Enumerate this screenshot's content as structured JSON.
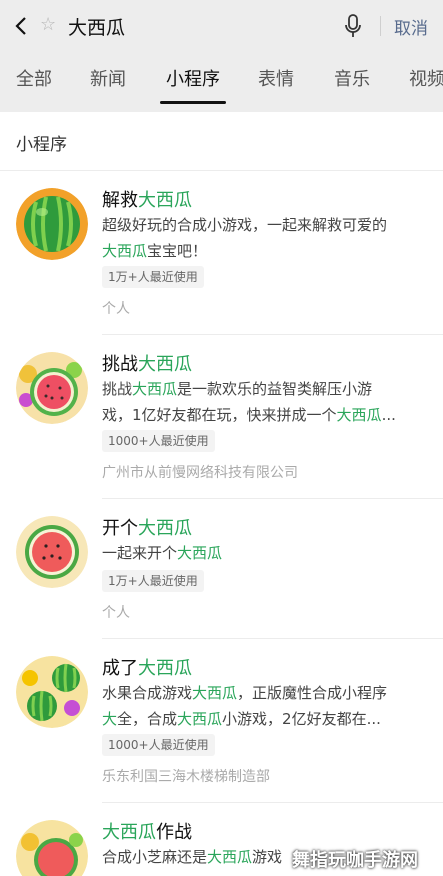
{
  "search": {
    "query": "大西瓜",
    "cancel_label": "取消"
  },
  "tabs": [
    {
      "label": "全部"
    },
    {
      "label": "新闻"
    },
    {
      "label": "小程序"
    },
    {
      "label": "表情"
    },
    {
      "label": "音乐"
    },
    {
      "label": "视频"
    }
  ],
  "section": {
    "title": "小程序"
  },
  "results": [
    {
      "title_pre": "解救",
      "title_hl": "大西瓜",
      "title_post": "",
      "desc": [
        "超级好玩的合成小游戏，一起来解救可爱的",
        "",
        "宝宝吧！"
      ],
      "desc_hl": "大西瓜",
      "badge": "1万+人最近使用",
      "source": "个人"
    },
    {
      "title_pre": "挑战",
      "title_hl": "大西瓜",
      "title_post": "",
      "desc_line1_pre": "挑战",
      "desc_line1_hl": "大西瓜",
      "desc_line1_post": "是一款欢乐的益智类解压小游",
      "desc_line2_pre": "戏，1亿好友都在玩，快来拼成一个",
      "desc_line2_hl": "大西瓜",
      "desc_line2_post": "...",
      "badge": "1000+人最近使用",
      "source": "广州市从前慢网络科技有限公司"
    },
    {
      "title_pre": "开个",
      "title_hl": "大西瓜",
      "title_post": "",
      "desc_line1_pre": " 一起来开个",
      "desc_line1_hl": "大西瓜",
      "desc_line1_post": "",
      "badge": "1万+人最近使用",
      "source": "个人"
    },
    {
      "title_pre": "成了",
      "title_hl": "大西瓜",
      "title_post": "",
      "desc_line1_pre": "水果合成游戏",
      "desc_line1_hl": "大西瓜",
      "desc_line1_post": "，正版魔性合成小程序",
      "desc_line2_hl1": "大",
      "desc_line2_mid": "全，合成",
      "desc_line2_hl2": "大西瓜",
      "desc_line2_post": "小游戏，2亿好友都在...",
      "badge": "1000+人最近使用",
      "source": "乐东利国三海木楼梯制造部"
    },
    {
      "title_pre": "",
      "title_hl": "大西瓜",
      "title_post": "作战",
      "desc_line1_pre": "合成小芝麻还是",
      "desc_line1_hl": "大西瓜",
      "desc_line1_post": "游戏"
    }
  ],
  "watermark": "舞指玩咖手游网",
  "colors": {
    "highlight": "#2aa55a",
    "cancel": "#586b8d",
    "background": "#ededed"
  }
}
